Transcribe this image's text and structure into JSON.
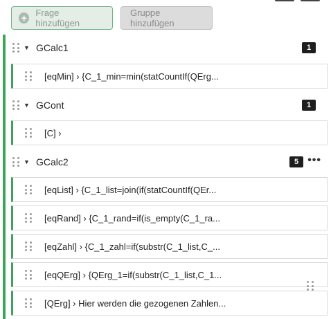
{
  "toolbar": {
    "add_question_label": "Frage hinzufügen",
    "add_group_label": "Gruppe hinzufügen"
  },
  "groups": [
    {
      "name": "GCalc1",
      "count": "1",
      "questions": [
        "[eqMin] › {C_1_min=min(statCountIf(QErg..."
      ]
    },
    {
      "name": "GCont",
      "count": "1",
      "questions": [
        "[C] ›"
      ]
    },
    {
      "name": "GCalc2",
      "count": "5",
      "questions": [
        "[eqList] › {C_1_list=join(if(statCountIf(QEr...",
        "[eqRand] › {C_1_rand=if(is_empty(C_1_ra...",
        "[eqZahl] › {C_1_zahl=if(substr(C_1_list,C_...",
        "[eqQErg] › {QErg_1=if(substr(C_1_list,C_1...",
        "[QErg] › Hier werden die gezogenen Zahlen..."
      ]
    }
  ],
  "colors": {
    "accent_green": "#3ca55a",
    "badge_bg": "#1e1e1e"
  }
}
